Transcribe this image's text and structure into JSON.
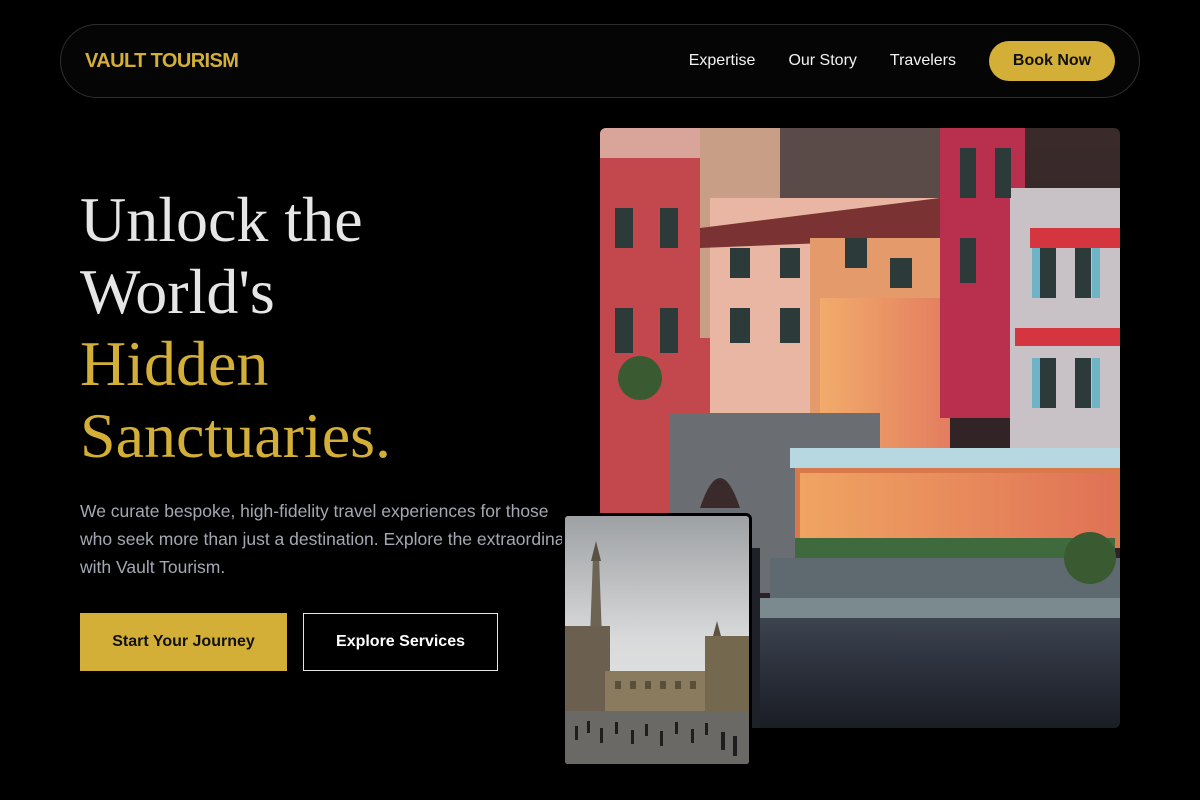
{
  "nav": {
    "brand": "VAULT TOURISM",
    "links": [
      "Expertise",
      "Our Story",
      "Travelers"
    ],
    "cta": "Book Now"
  },
  "hero": {
    "headline_white": [
      "Unlock the",
      "World's"
    ],
    "headline_gold": [
      "Hidden",
      "Sanctuaries."
    ],
    "description": "We curate bespoke, high-fidelity travel experiences for those who seek more than just a destination. Explore the extraordinary with Vault Tourism.",
    "primary_cta": "Start Your Journey",
    "secondary_cta": "Explore Services"
  },
  "colors": {
    "accent": "#d4af37",
    "background": "#000000",
    "muted_text": "#a3a8b2"
  },
  "images": {
    "main": "lakeside-village-dusk-photo",
    "secondary": "grand-place-town-square-photo"
  }
}
